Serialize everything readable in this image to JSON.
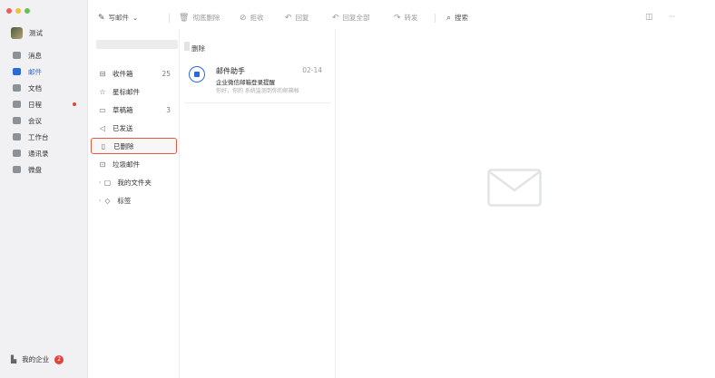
{
  "nav": {
    "user_name": "测试",
    "items": [
      {
        "label": "消息",
        "icon": "chat-icon"
      },
      {
        "label": "邮件",
        "icon": "mail-icon",
        "active": true
      },
      {
        "label": "文档",
        "icon": "document-icon"
      },
      {
        "label": "日程",
        "icon": "calendar-icon",
        "dot": true
      },
      {
        "label": "会议",
        "icon": "meeting-icon"
      },
      {
        "label": "工作台",
        "icon": "workbench-icon"
      },
      {
        "label": "通讯录",
        "icon": "contacts-icon"
      },
      {
        "label": "微盘",
        "icon": "drive-icon"
      }
    ],
    "footer_label": "我的企业",
    "footer_badge": "2"
  },
  "toolbar": {
    "write": "写邮件",
    "delete": "彻底删除",
    "reject": "拒收",
    "reply": "回复",
    "reply_all": "回复全部",
    "forward": "转发",
    "search": "搜索",
    "more": "···"
  },
  "folders": {
    "items": [
      {
        "label": "收件箱",
        "icon": "inbox-icon",
        "count": "25"
      },
      {
        "label": "星标邮件",
        "icon": "star-icon",
        "count": ""
      },
      {
        "label": "草稿箱",
        "icon": "draft-icon",
        "count": "3"
      },
      {
        "label": "已发送",
        "icon": "sent-icon",
        "count": ""
      },
      {
        "label": "已删除",
        "icon": "trash-icon",
        "count": "",
        "selected": true
      },
      {
        "label": "垃圾邮件",
        "icon": "spam-icon",
        "count": ""
      },
      {
        "label": "我的文件夹",
        "icon": "folder-icon",
        "count": "",
        "caret": true
      },
      {
        "label": "标签",
        "icon": "tag-icon",
        "count": "",
        "caret": true
      }
    ]
  },
  "list": {
    "title": "删除",
    "message": {
      "sender": "邮件助手",
      "time": "02-14",
      "subject": "企业微信邮箱登录提醒",
      "preview": "你好，你的 系统监测到你的邮箱帐"
    }
  },
  "colors": {
    "accent": "#2a6bd9",
    "selection_border": "#e9573f",
    "badge": "#e0453b"
  }
}
